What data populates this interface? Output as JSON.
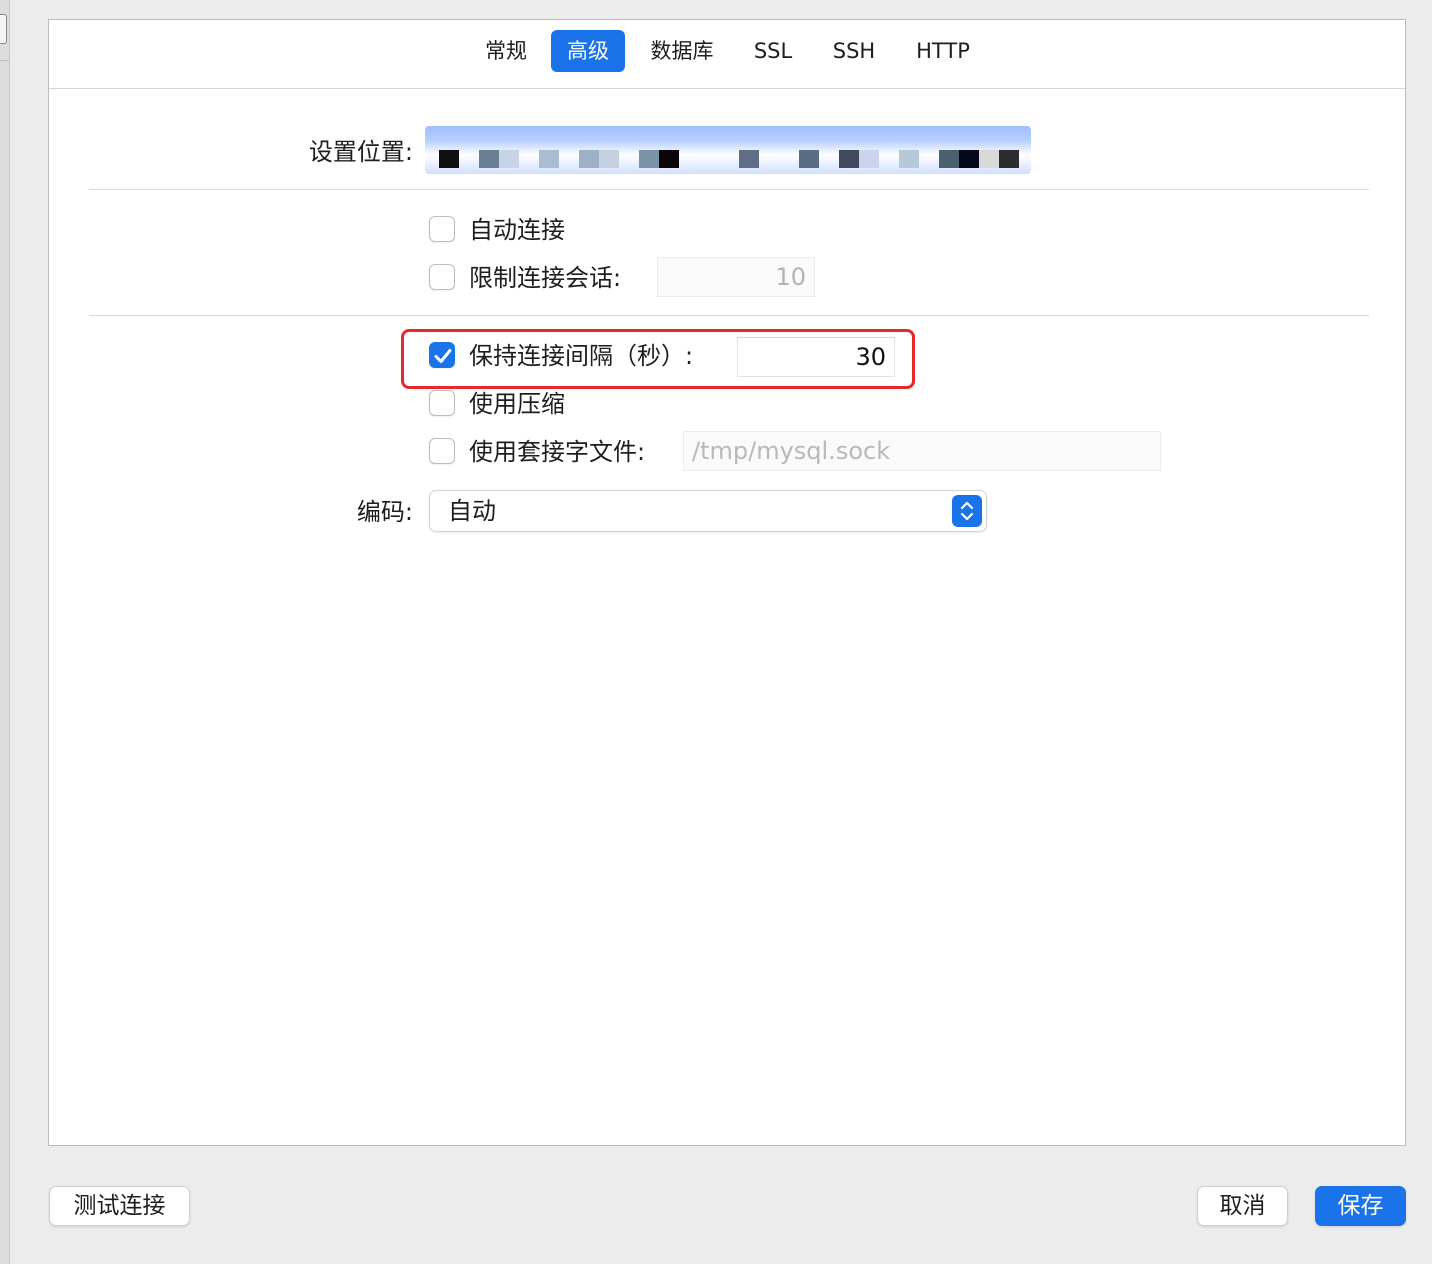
{
  "tabs": [
    {
      "label": "常规",
      "active": false
    },
    {
      "label": "高级",
      "active": true
    },
    {
      "label": "数据库",
      "active": false
    },
    {
      "label": "SSL",
      "active": false
    },
    {
      "label": "SSH",
      "active": false
    },
    {
      "label": "HTTP",
      "active": false
    }
  ],
  "settings_location": {
    "label": "设置位置:"
  },
  "auto_connect": {
    "label": "自动连接",
    "checked": false
  },
  "limit_sessions": {
    "label": "限制连接会话:",
    "checked": false,
    "value": "10"
  },
  "keepalive": {
    "label": "保持连接间隔（秒）:",
    "checked": true,
    "value": "30"
  },
  "use_compression": {
    "label": "使用压缩",
    "checked": false
  },
  "use_socket": {
    "label": "使用套接字文件:",
    "checked": false,
    "placeholder": "/tmp/mysql.sock"
  },
  "encoding": {
    "label": "编码:",
    "value": "自动"
  },
  "buttons": {
    "test_connection": "测试连接",
    "cancel": "取消",
    "save": "保存"
  },
  "colors": {
    "accent": "#1a73e8",
    "highlight": "#e8282b"
  }
}
